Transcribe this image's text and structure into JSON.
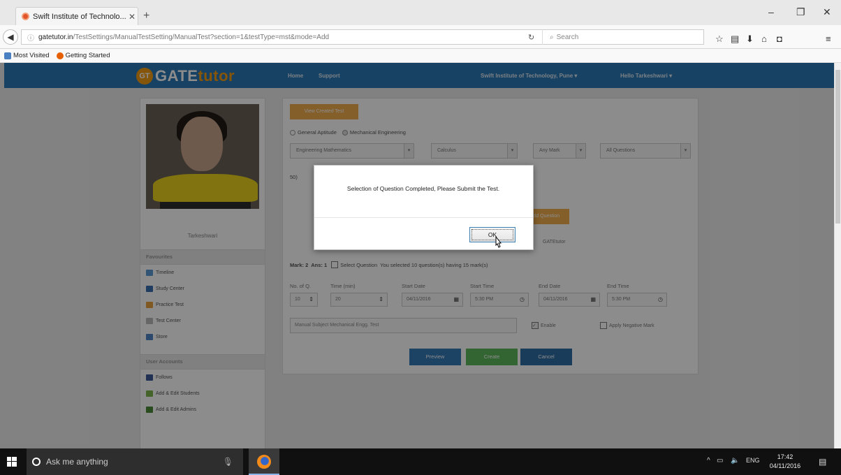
{
  "browser": {
    "tab_title": "Swift Institute of Technolo...",
    "tab_close": "✕",
    "new_tab": "+",
    "window_controls": [
      "‒",
      "❐",
      "✕"
    ],
    "url_host": "gatetutor.in",
    "url_path": "/TestSettings/ManualTestSetting/ManualTest?section=1&testType=mst&mode=Add",
    "search_placeholder": "Search",
    "bookmarks": [
      "Most Visited",
      "Getting Started"
    ]
  },
  "site": {
    "logo_badge": "GT",
    "logo_main": "GATE",
    "logo_accent": "tutor",
    "nav": [
      "Home",
      "Support"
    ],
    "institute_menu": "Swift Institute of Technology, Pune ▾",
    "user_menu": "Hello Tarkeshwari ▾"
  },
  "sidebar": {
    "username": "Tarkeshwari",
    "section_favorites": "Favourites",
    "favorites": [
      "Timeline",
      "Study Center",
      "Practice Test",
      "Test Center",
      "Store"
    ],
    "section_accounts": "User Accounts",
    "accounts": [
      "Follows",
      "Add & Edit Students",
      "Add & Edit Admins"
    ]
  },
  "main": {
    "view_created_btn": "View Created Test",
    "radio_general": "General Aptitude",
    "radio_mechanical": "Mechanical Engineering",
    "selects": [
      "Engineering Mathematics",
      "Calculus",
      "Any Mark",
      "All Questions"
    ],
    "question_no": "50)",
    "add_btn": "Add Question",
    "source_text": "GATEtutor",
    "marks_label": "Mark: 2",
    "ans_label": "Ans: 1",
    "select_question": "Select Question",
    "selected_summary": "You selected 10 question(s) having 15 mark(s)",
    "labels": [
      "No. of Q.",
      "Time (min)",
      "Start Date",
      "Start Time",
      "End Date",
      "End Time"
    ],
    "values": [
      "10",
      "20",
      "04/11/2016",
      "5:30 PM",
      "04/11/2016",
      "5:30 PM"
    ],
    "description": "Manual Subject Mechanical Engg. Test",
    "enable_label": "Enable",
    "negative_label": "Apply Negative Mark",
    "btn_preview": "Preview",
    "btn_create": "Create",
    "btn_cancel": "Cancel"
  },
  "modal": {
    "message": "Selection of Question Completed, Please Submit the Test.",
    "ok": "OK"
  },
  "taskbar": {
    "search_placeholder": "Ask me anything",
    "tray_lang": "ENG",
    "time": "17:42",
    "date": "04/11/2016"
  },
  "colors": {
    "nav_blue": "#2b78b4",
    "orange": "#f0ad4e",
    "preview_blue": "#337ab7",
    "create_green": "#5cb85c",
    "cancel_blue": "#2e6da4"
  }
}
